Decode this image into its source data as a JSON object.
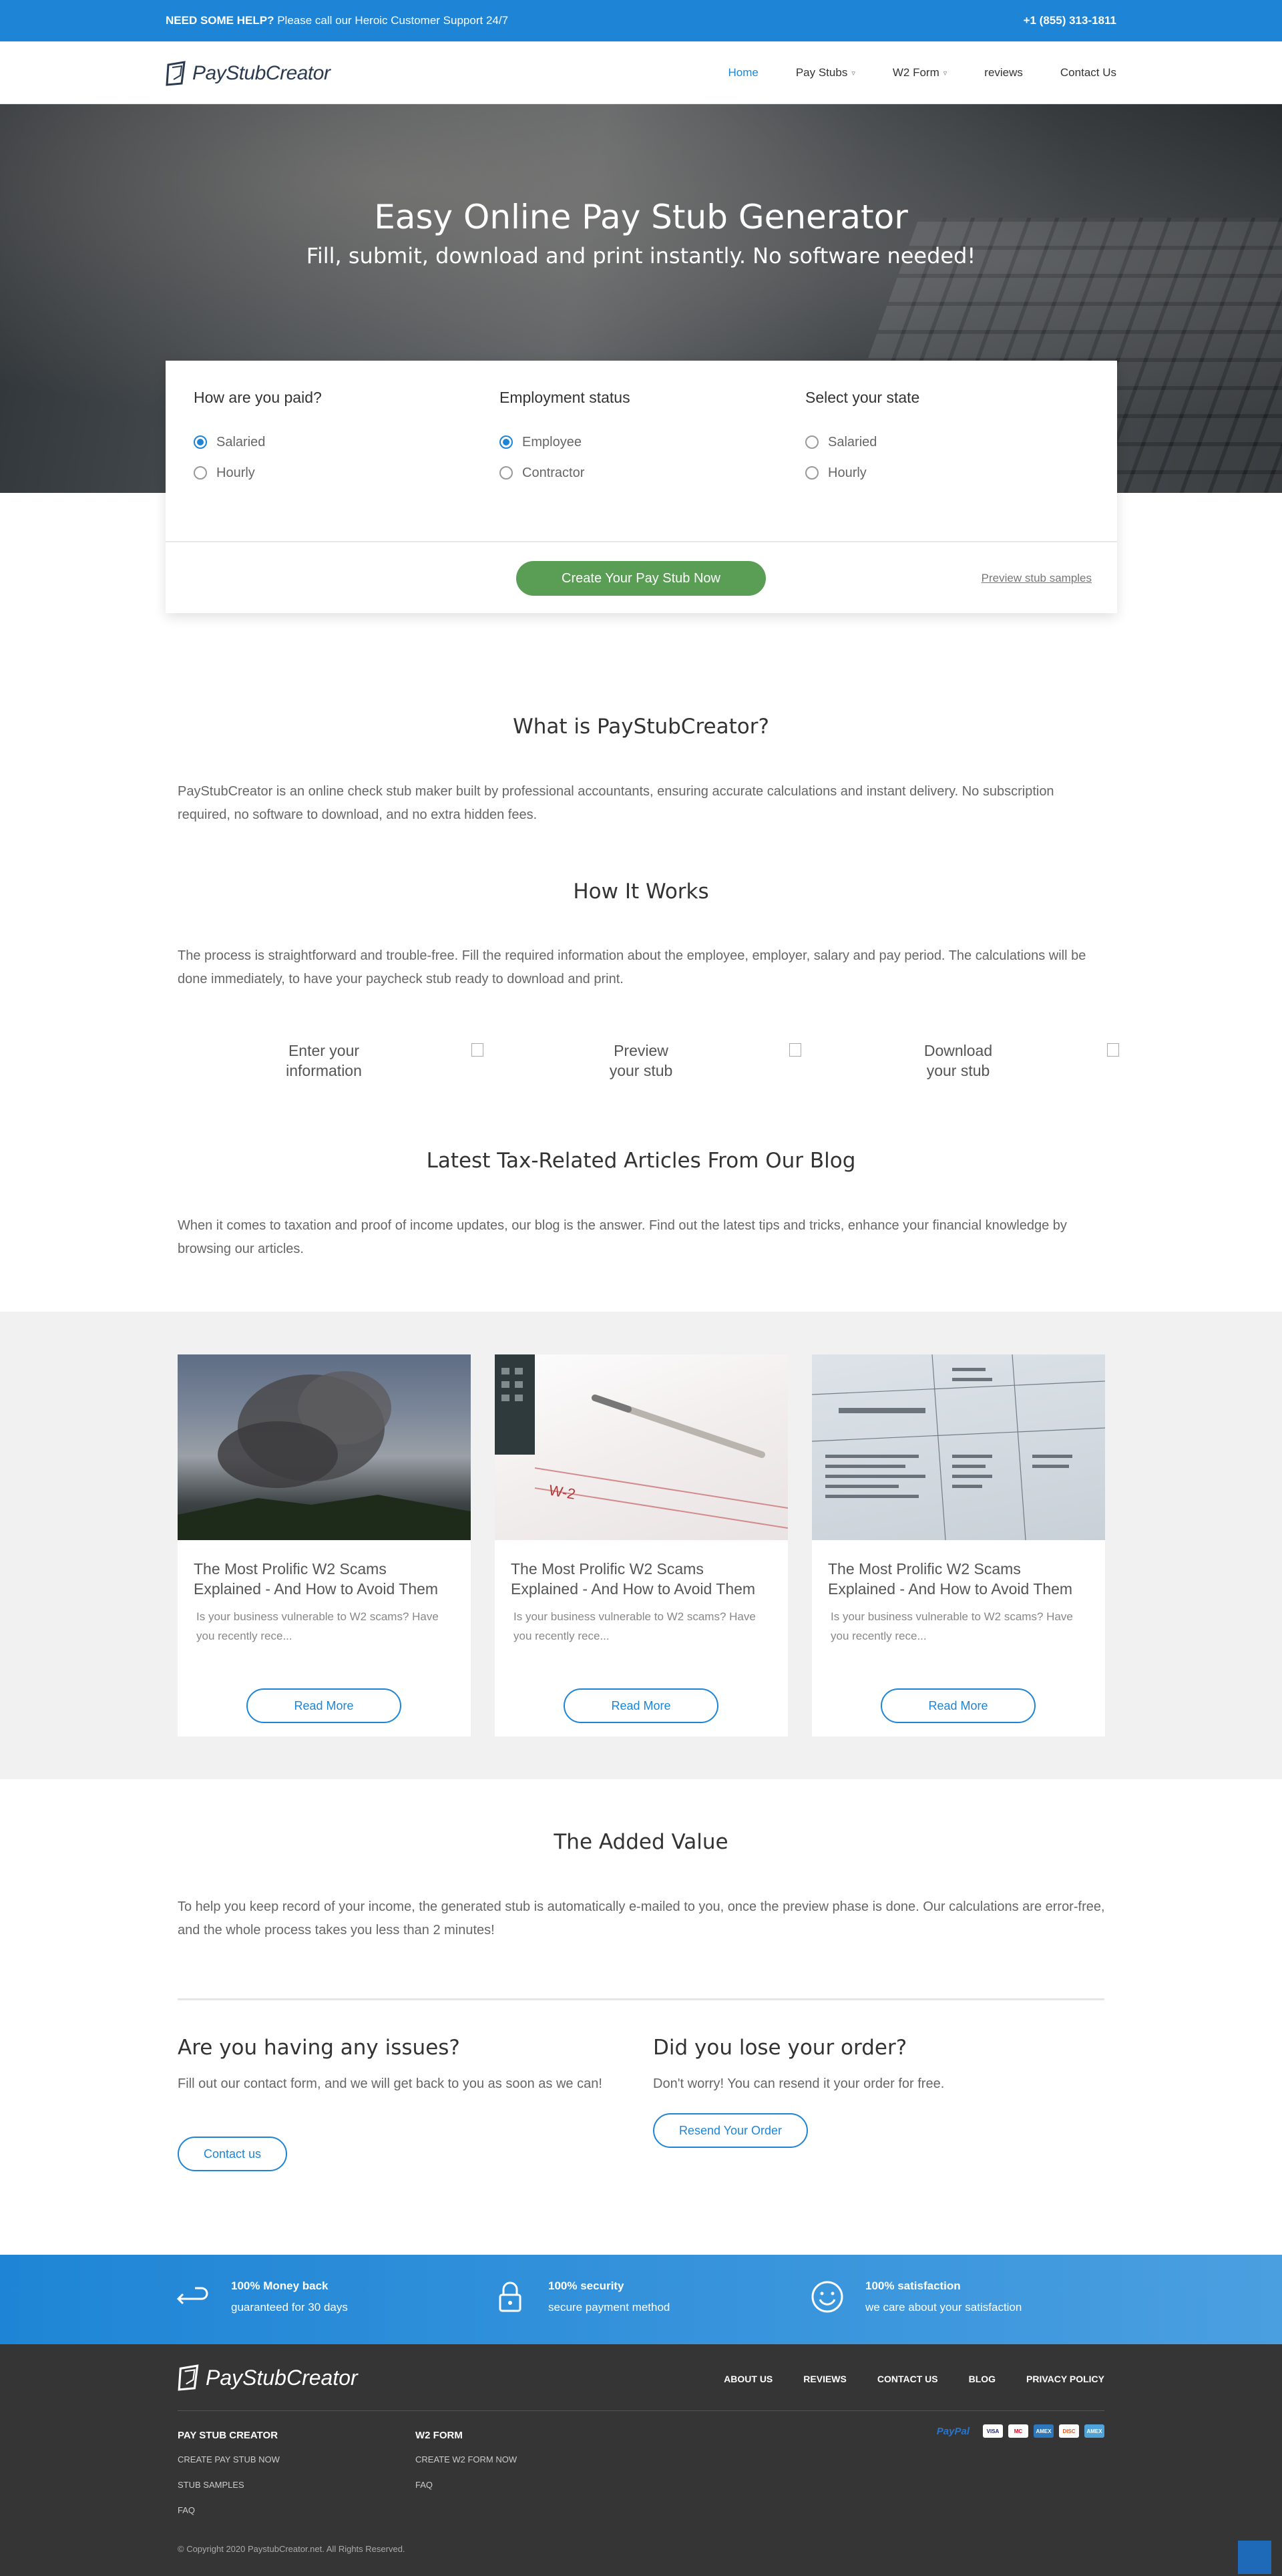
{
  "topbar": {
    "help_bold": "NEED SOME HELP?",
    "help_text": "Please call our Heroic Customer Support 24/7",
    "phone": "+1 (855) 313-1811"
  },
  "header": {
    "logo_text": "PayStubCreator",
    "nav": {
      "home": "Home",
      "pay_stubs": "Pay Stubs",
      "w2_form": "W2 Form",
      "reviews": "reviews",
      "contact": "Contact Us"
    }
  },
  "hero": {
    "title": "Easy Online Pay Stub Generator",
    "subtitle": "Fill, submit, download and print instantly. No software needed!"
  },
  "form": {
    "paid": {
      "title": "How are you paid?",
      "opt1": "Salaried",
      "opt2": "Hourly"
    },
    "employment": {
      "title": "Employment status",
      "opt1": "Employee",
      "opt2": "Contractor"
    },
    "state": {
      "title": "Select your state",
      "opt1": "Salaried",
      "opt2": "Hourly"
    },
    "cta": "Create Your Pay Stub Now",
    "preview": "Preview stub samples"
  },
  "what": {
    "title": "What is PayStubCreator?",
    "text": "PayStubCreator is an online check stub maker built by professional accountants, ensuring accurate calculations and instant delivery. No subscription required, no software to download, and no extra hidden fees."
  },
  "how": {
    "title": "How It Works",
    "text": "The process is straightforward and trouble-free. Fill the required information about the employee, employer, salary and pay period. The calculations will be done immediately, to have your paycheck stub ready to download and print.",
    "steps": [
      {
        "l1": "Enter your",
        "l2": "information"
      },
      {
        "l1": "Preview",
        "l2": "your stub"
      },
      {
        "l1": "Download",
        "l2": "your stub"
      }
    ]
  },
  "blog": {
    "title": "Latest Tax-Related Articles From Our Blog",
    "text": "When it comes to taxation and proof of income updates, our blog is the answer. Find out the latest tips and tricks, enhance your financial knowledge by browsing our articles.",
    "cards": [
      {
        "title": "The Most Prolific W2 Scams Explained - And How to Avoid Them",
        "excerpt": "Is your business vulnerable to W2 scams? Have you recently rece...",
        "button": "Read More"
      },
      {
        "title": "The Most Prolific W2 Scams Explained - And How to Avoid Them",
        "excerpt": "Is your business vulnerable to W2 scams? Have you recently rece...",
        "button": "Read More"
      },
      {
        "title": "The Most Prolific W2 Scams Explained - And How to Avoid Them",
        "excerpt": "Is your business vulnerable to W2 scams? Have you recently rece...",
        "button": "Read More"
      }
    ]
  },
  "added": {
    "title": "The Added Value",
    "text": "To help you keep record of your income, the generated stub is automatically e-mailed to you, once the preview phase is done. Our calculations are error-free, and the whole process takes you less than 2 minutes!"
  },
  "issues": {
    "title": "Are you having any issues?",
    "text": "Fill out our contact form, and we will get back to you as soon as we can!",
    "button": "Contact us"
  },
  "lost": {
    "title": "Did you lose your order?",
    "text": "Don't worry! You can resend it your order for free.",
    "button": "Resend Your Order"
  },
  "features": [
    {
      "icon": "return-arrow-icon",
      "t1": "100% Money back",
      "t2": "guaranteed for 30 days"
    },
    {
      "icon": "lock-icon",
      "t1": "100% security",
      "t2": "secure payment method"
    },
    {
      "icon": "smiley-icon",
      "t1": "100% satisfaction",
      "t2": "we care about your satisfaction"
    }
  ],
  "footer": {
    "logo_text": "PayStubCreator",
    "nav": {
      "about": "ABOUT US",
      "reviews": "REVIEWS",
      "contact": "CONTACT US",
      "blog": "BLOG",
      "privacy": "PRIVACY POLICY"
    },
    "col1": {
      "title": "PAY STUB CREATOR",
      "l1": "CREATE PAY STUB NOW",
      "l2": "STUB SAMPLES",
      "l3": "FAQ"
    },
    "col2": {
      "title": "W2 FORM",
      "l1": "CREATE W2 FORM NOW",
      "l2": "FAQ"
    },
    "paypal": "PayPal",
    "cards": {
      "visa": "VISA",
      "mc": "MC",
      "amex": "AMEX",
      "disc": "DISC",
      "other": "AMEX"
    },
    "copyright": "© Copyright 2020 PaystubCreator.net. All Rights Reserved."
  },
  "colors": {
    "accent": "#1e85d6",
    "cta_green": "#5a9e55",
    "footer_bg": "#353535",
    "blog_bg": "#f1f1f1"
  }
}
